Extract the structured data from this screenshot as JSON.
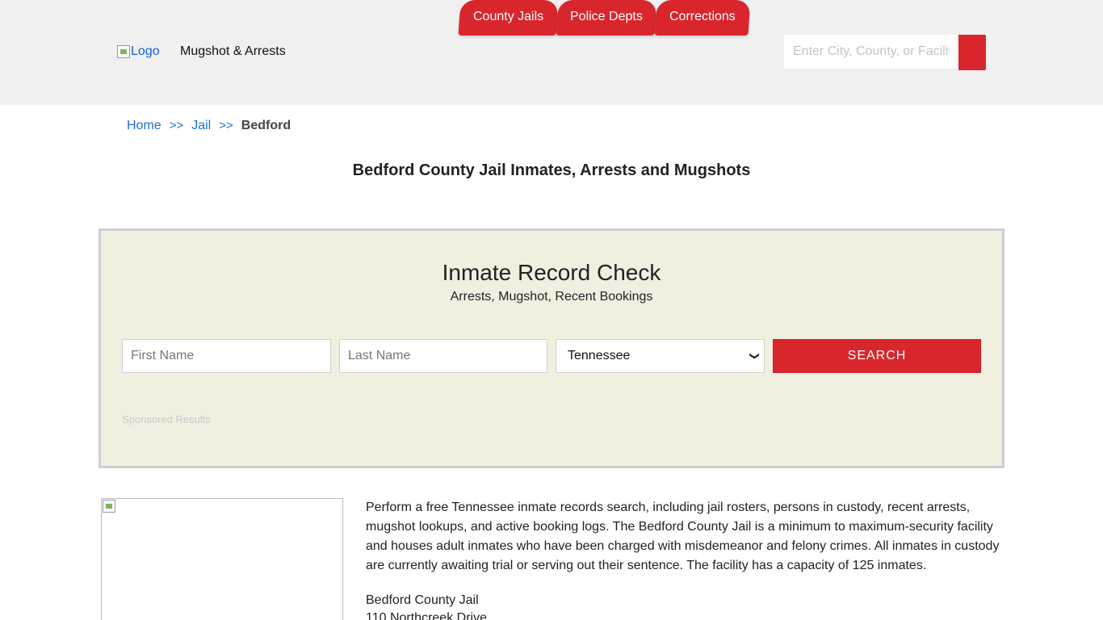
{
  "header": {
    "logo_alt": "Logo",
    "site_name": "Mugshot & Arrests",
    "nav": [
      {
        "label": "County Jails"
      },
      {
        "label": "Police Depts"
      },
      {
        "label": "Corrections"
      }
    ],
    "search_placeholder": "Enter City, County, or Facility"
  },
  "breadcrumb": {
    "home": "Home",
    "jail": "Jail",
    "current": "Bedford",
    "separator": ">>"
  },
  "page_title": "Bedford County Jail Inmates, Arrests and Mugshots",
  "record_check": {
    "title": "Inmate Record Check",
    "subtitle": "Arrests, Mugshot, Recent Bookings",
    "first_name_placeholder": "First Name",
    "last_name_placeholder": "Last Name",
    "state_selected": "Tennessee",
    "search_label": "SEARCH",
    "sponsored": "Sponsored Results"
  },
  "content": {
    "description": "Perform a free Tennessee inmate records search, including jail rosters, persons in custody, recent arrests, mugshot lookups, and active booking logs. The Bedford County Jail is a minimum to maximum-security facility and houses adult inmates who have been charged with misdemeanor and felony crimes. All inmates in custody are currently awaiting trial or serving out their sentence. The facility has a capacity of 125 inmates.",
    "address_name": "Bedford County Jail",
    "address_street": "110 Northcreek Drive"
  },
  "colors": {
    "accent": "#d9262d",
    "header_bg": "#f0f0f0",
    "panel_bg": "#f1efe0",
    "link": "#1a6fd6"
  }
}
